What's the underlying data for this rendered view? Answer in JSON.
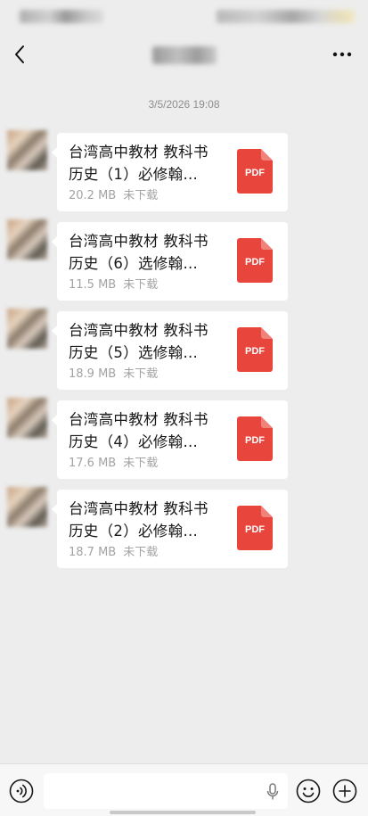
{
  "chat": {
    "timestamp": "3/5/2026 19:08"
  },
  "messages": [
    {
      "name": "台湾高中教材 教科书\n历史（1）必修翰…",
      "size": "20.2 MB",
      "status": "未下载",
      "file_type": "PDF"
    },
    {
      "name": "台湾高中教材 教科书\n历史（6）选修翰…",
      "size": "11.5 MB",
      "status": "未下载",
      "file_type": "PDF"
    },
    {
      "name": "台湾高中教材 教科书\n历史（5）选修翰…",
      "size": "18.9 MB",
      "status": "未下载",
      "file_type": "PDF"
    },
    {
      "name": "台湾高中教材 教科书\n历史（4）必修翰…",
      "size": "17.6 MB",
      "status": "未下载",
      "file_type": "PDF"
    },
    {
      "name": "台湾高中教材 教科书\n历史（2）必修翰…",
      "size": "18.7 MB",
      "status": "未下载",
      "file_type": "PDF"
    }
  ],
  "icons": {
    "back": "chevron-left-icon",
    "more": "more-dots-icon",
    "voice": "voice-icon",
    "mic": "microphone-icon",
    "emoji": "emoji-icon",
    "plus": "plus-icon",
    "file": "pdf-file-icon"
  },
  "colors": {
    "background": "#ededed",
    "bubble": "#ffffff",
    "pdf": "#e8453c",
    "meta_text": "#a3a3a3"
  }
}
